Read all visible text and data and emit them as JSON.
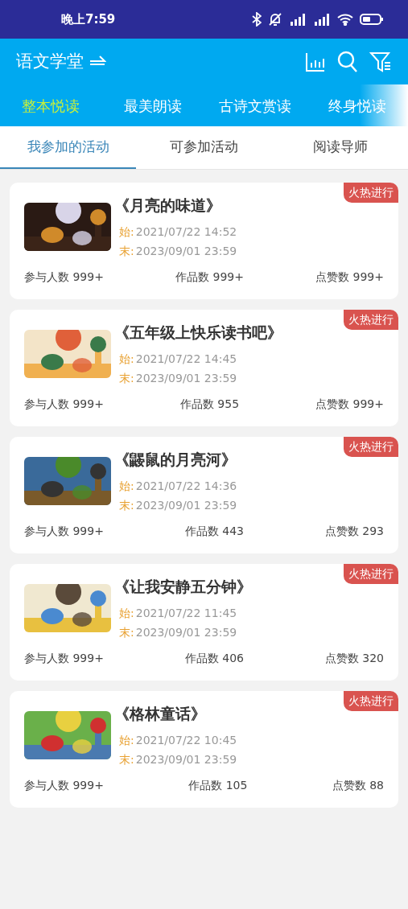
{
  "status_bar": {
    "time": "晚上7:59"
  },
  "app_bar": {
    "title": "语文学堂"
  },
  "category_tabs": [
    {
      "label": "整本悦读",
      "selected": true
    },
    {
      "label": "最美朗读",
      "selected": false
    },
    {
      "label": "古诗文赏读",
      "selected": false
    },
    {
      "label": "终身悦读",
      "selected": false
    }
  ],
  "sub_tabs": [
    {
      "label": "我参加的活动",
      "selected": true
    },
    {
      "label": "可参加活动",
      "selected": false
    },
    {
      "label": "阅读导师",
      "selected": false
    }
  ],
  "activities": [
    {
      "title": "《月亮的味道》",
      "badge": "火热进行",
      "start_label": "始:",
      "start": "2021/07/22 14:52",
      "end_label": "末:",
      "end": "2023/09/01 23:59",
      "stats": [
        "参与人数 999+",
        "作品数 999+",
        "点赞数 999+"
      ]
    },
    {
      "title": "《五年级上快乐读书吧》",
      "badge": "火热进行",
      "start_label": "始:",
      "start": "2021/07/22 14:45",
      "end_label": "末:",
      "end": "2023/09/01 23:59",
      "stats": [
        "参与人数 999+",
        "作品数 955",
        "点赞数 999+"
      ]
    },
    {
      "title": "《鼹鼠的月亮河》",
      "badge": "火热进行",
      "start_label": "始:",
      "start": "2021/07/22 14:36",
      "end_label": "末:",
      "end": "2023/09/01 23:59",
      "stats": [
        "参与人数 999+",
        "作品数 443",
        "点赞数 293"
      ]
    },
    {
      "title": "《让我安静五分钟》",
      "badge": "火热进行",
      "start_label": "始:",
      "start": "2021/07/22 11:45",
      "end_label": "末:",
      "end": "2023/09/01 23:59",
      "stats": [
        "参与人数 999+",
        "作品数 406",
        "点赞数 320"
      ]
    },
    {
      "title": "《格林童话》",
      "badge": "火热进行",
      "start_label": "始:",
      "start": "2021/07/22 10:45",
      "end_label": "末:",
      "end": "2023/09/01 23:59",
      "stats": [
        "参与人数 999+",
        "作品数 105",
        "点赞数 88"
      ]
    }
  ]
}
